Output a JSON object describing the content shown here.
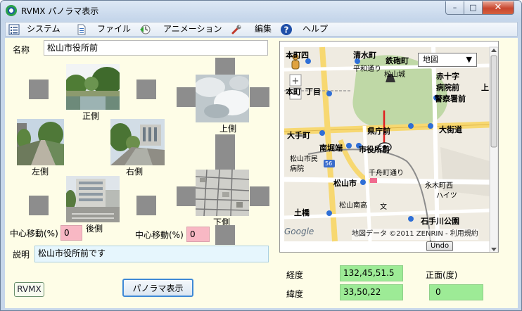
{
  "window": {
    "title": "RVMX パノラマ表示",
    "close_glyph": "✕",
    "min_glyph": "–",
    "max_glyph": "□"
  },
  "menu": [
    {
      "label": "システム",
      "icon": "system-icon"
    },
    {
      "label": "ファイル",
      "icon": "file-icon"
    },
    {
      "label": "アニメーション",
      "icon": "animation-icon"
    },
    {
      "label": "編集",
      "icon": "edit-icon"
    },
    {
      "label": "ヘルプ",
      "icon": "help-icon"
    }
  ],
  "form": {
    "name_label": "名称",
    "name_value": "松山市役所前",
    "desc_label": "説明",
    "desc_value": "松山市役所前です"
  },
  "panorama": {
    "front_label": "正側",
    "left_label": "左側",
    "right_label": "右側",
    "back_label": "後側",
    "up_label": "上側",
    "down_label": "下側",
    "center_shift_label": "中心移動(%)",
    "center_shift_value_1": "0",
    "center_shift_value_2": "0"
  },
  "map": {
    "type_select": "地図",
    "copyright": "地図データ ©2011 ZENRIN - 利用規約",
    "logo": "Google",
    "undo_label": "Undo",
    "place_labels": [
      "本町四",
      "清水町",
      "鉄砲町",
      "平和通り",
      "赤十字",
      "病院前",
      "松山城",
      "本町",
      "丁目",
      "警察署前",
      "上",
      "大手町",
      "県庁前",
      "大街道",
      "松山市民",
      "病院",
      "南堀端",
      "市役所前",
      "千舟町通り",
      "56",
      "松山市",
      "永木町西",
      "ハイツ",
      "土橋",
      "松山南高",
      "文",
      "石手川公園"
    ]
  },
  "coords": {
    "lon_label": "経度",
    "lon_value": "132,45,51.5",
    "lat_label": "緯度",
    "lat_value": "33,50,22",
    "heading_label": "正面(度)",
    "heading_value": "0"
  },
  "buttons": {
    "rvmx": "RVMX",
    "panorama": "パノラマ表示"
  }
}
